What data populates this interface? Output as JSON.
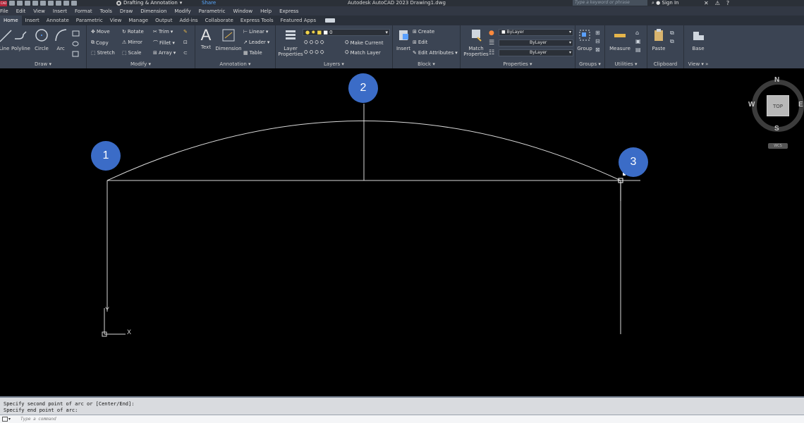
{
  "titlebar": {
    "logo": "CAD",
    "workspace": "Drafting & Annotation",
    "share": "Share",
    "title": "Autodesk AutoCAD 2023   Drawing1.dwg",
    "search_placeholder": "Type a keyword or phrase",
    "sign_in": "Sign In"
  },
  "menu": [
    "File",
    "Edit",
    "View",
    "Insert",
    "Format",
    "Tools",
    "Draw",
    "Dimension",
    "Modify",
    "Parametric",
    "Window",
    "Help",
    "Express"
  ],
  "tabs": [
    "Home",
    "Insert",
    "Annotate",
    "Parametric",
    "View",
    "Manage",
    "Output",
    "Add-ins",
    "Collaborate",
    "Express Tools",
    "Featured Apps"
  ],
  "active_tab": "Home",
  "ribbon": {
    "draw": {
      "title": "Draw",
      "line": "Line",
      "polyline": "Polyline",
      "circle": "Circle",
      "arc": "Arc"
    },
    "modify": {
      "title": "Modify",
      "move": "Move",
      "rotate": "Rotate",
      "trim": "Trim",
      "copy": "Copy",
      "mirror": "Mirror",
      "fillet": "Fillet",
      "stretch": "Stretch",
      "scale": "Scale",
      "array": "Array"
    },
    "annotation": {
      "title": "Annotation",
      "text": "Text",
      "dimension": "Dimension",
      "linear": "Linear",
      "leader": "Leader",
      "table": "Table"
    },
    "layers": {
      "title": "Layers",
      "layer_properties_1": "Layer",
      "layer_properties_2": "Properties",
      "current_layer": "0",
      "make_current": "Make Current",
      "match_layer": "Match Layer"
    },
    "block": {
      "title": "Block",
      "insert": "Insert",
      "create": "Create",
      "edit": "Edit",
      "edit_attributes": "Edit Attributes"
    },
    "properties": {
      "title": "Properties",
      "match_1": "Match",
      "match_2": "Properties",
      "color": "ByLayer",
      "linetype": "ByLayer",
      "lineweight": "ByLayer"
    },
    "groups": {
      "title": "Groups",
      "group": "Group"
    },
    "utilities": {
      "title": "Utilities",
      "measure": "Measure"
    },
    "clipboard": {
      "title": "Clipboard",
      "paste": "Paste"
    },
    "view": {
      "title": "View",
      "base": "Base"
    }
  },
  "markers": [
    "1",
    "2",
    "3"
  ],
  "viewcube": {
    "n": "N",
    "s": "S",
    "e": "E",
    "w": "W",
    "top": "TOP",
    "wcs": "WCS"
  },
  "ucs": {
    "x": "X",
    "y": "Y"
  },
  "command": {
    "history_1": "Specify second point of arc or [Center/End]:",
    "history_2": "Specify end point of arc:",
    "placeholder": "Type a command"
  }
}
